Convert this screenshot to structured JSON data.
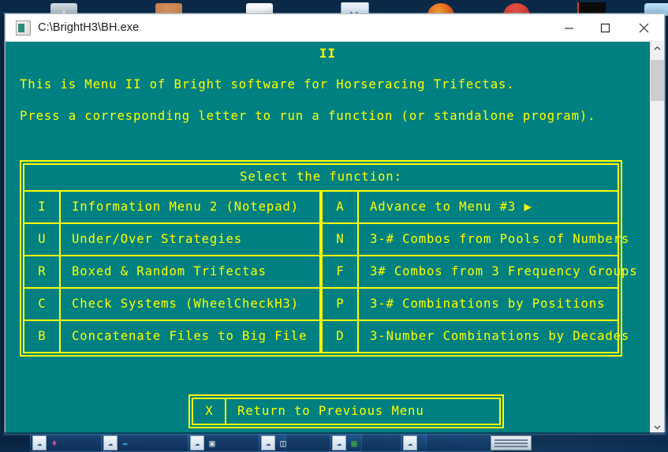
{
  "window": {
    "title": "C:\\BrightH3\\BH.exe",
    "app_icon": "console-app-icon",
    "minimize_label": "Minimize",
    "maximize_label": "Maximize",
    "close_label": "Close"
  },
  "colors": {
    "console_background": "#008080",
    "console_text": "#ffff00",
    "titlebar_background": "#ffffff",
    "titlebar_text": "#1b1b1b",
    "scrollbar_track": "#f0f0f0",
    "scrollbar_thumb": "#cdcdcd"
  },
  "console": {
    "heading": "II",
    "intro_line_1": "This is Menu II of Bright software for Horseracing Trifectas.",
    "intro_line_2": "Press a corresponding letter to run a function (or standalone program).",
    "menu_header": "Select the function:",
    "left_items": [
      {
        "key": "I",
        "label": "Information Menu 2 (Notepad)"
      },
      {
        "key": "U",
        "label": "Under/Over Strategies"
      },
      {
        "key": "R",
        "label": "Boxed & Random Trifectas"
      },
      {
        "key": "C",
        "label": "Check Systems (WheelCheckH3)"
      },
      {
        "key": "B",
        "label": "Concatenate Files to Big File"
      }
    ],
    "right_items": [
      {
        "key": "A",
        "label": "Advance to Menu #3 ▶"
      },
      {
        "key": "N",
        "label": "3-# Combos from Pools of Numbers"
      },
      {
        "key": "F",
        "label": "3# Combos from 3 Frequency Groups"
      },
      {
        "key": "P",
        "label": "3-# Combinations by Positions"
      },
      {
        "key": "D",
        "label": "3-Number Combinations by Decades"
      }
    ],
    "bottom_item": {
      "key": "X",
      "label": "Return to Previous Menu"
    }
  },
  "scrollbar": {
    "up_arrow": "⌃",
    "down_arrow": "⌄"
  },
  "desktop": {
    "top_icons": [
      {
        "name": "mountains-photo-icon",
        "glyph": "⛰"
      },
      {
        "name": "person-photo-icon",
        "glyph": "👤"
      },
      {
        "name": "document-stack-icon",
        "glyph": "📄"
      },
      {
        "name": "word-document-icon",
        "glyph": "W"
      },
      {
        "name": "firefox-browser-icon",
        "glyph": "🌐"
      },
      {
        "name": "red-oval-icon",
        "glyph": "⬬"
      },
      {
        "name": "terminal-window-icon",
        "glyph": "▮"
      },
      {
        "name": "settings-gear-icon",
        "glyph": "⚙"
      }
    ],
    "taskbar_items": [
      {
        "name": "taskbar-item-1",
        "glyph": "🖌"
      },
      {
        "name": "taskbar-item-2",
        "glyph": "✒"
      },
      {
        "name": "taskbar-item-3",
        "glyph": "📰"
      },
      {
        "name": "taskbar-item-4",
        "glyph": "🗂"
      },
      {
        "name": "taskbar-item-5",
        "glyph": "📗"
      },
      {
        "name": "taskbar-item-6",
        "glyph": ""
      }
    ]
  }
}
